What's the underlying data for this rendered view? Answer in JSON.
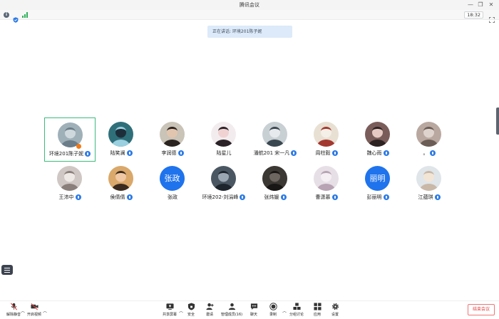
{
  "window": {
    "title": "腾讯会议"
  },
  "status": {
    "time": "18:32"
  },
  "banner": {
    "text": "正在讲话: 环境201陈子妮"
  },
  "colors": {
    "accent": "#1f73ec",
    "active_border": "#3dbb7d",
    "end_red": "#e43e3e",
    "mic_off": "#f07a16"
  },
  "participants": [
    {
      "name": "环境201陈子妮",
      "avatar": "photo-1",
      "active": true,
      "mic": true,
      "mic_off_badge": true
    },
    {
      "name": "陆笑澜",
      "avatar": "photo-2",
      "mic": true
    },
    {
      "name": "李润德",
      "avatar": "photo-3",
      "mic": true
    },
    {
      "name": "陆星儿",
      "avatar": "photo-4",
      "mic": false
    },
    {
      "name": "潘航201 宋一凡",
      "avatar": "photo-5",
      "mic": true
    },
    {
      "name": "周柱毅",
      "avatar": "photo-6",
      "mic": true
    },
    {
      "name": "魏心雨",
      "avatar": "photo-7",
      "mic": true
    },
    {
      "name": "。",
      "avatar": "photo-8",
      "mic": true
    },
    {
      "name": "王沛中",
      "avatar": "photo-9",
      "mic": true
    },
    {
      "name": "侯倩倩",
      "avatar": "photo-10",
      "mic": true
    },
    {
      "name": "张政",
      "avatar_text": "张政",
      "mic": false
    },
    {
      "name": "环境202-刘涓峰",
      "avatar": "photo-11",
      "mic": true
    },
    {
      "name": "张炜媛",
      "avatar": "photo-12",
      "mic": true
    },
    {
      "name": "曹潇慕",
      "avatar": "photo-13",
      "mic": true
    },
    {
      "name": "彭丽明",
      "avatar_text": "丽明",
      "mic": true
    },
    {
      "name": "江蕴琪",
      "avatar": "photo-14",
      "mic": true
    }
  ],
  "toolbar": {
    "left": [
      {
        "label": "解除静音",
        "icon": "mic-muted-icon"
      },
      {
        "label": "开启视频",
        "icon": "camera-off-icon"
      }
    ],
    "center": [
      {
        "label": "共享屏幕",
        "icon": "screen-share-icon"
      },
      {
        "label": "安全",
        "icon": "shield-icon"
      },
      {
        "label": "邀请",
        "icon": "invite-icon"
      },
      {
        "label": "管理成员(16)",
        "icon": "members-icon"
      },
      {
        "label": "聊天",
        "icon": "chat-icon"
      },
      {
        "label": "录制",
        "icon": "record-icon"
      },
      {
        "label": "分组讨论",
        "icon": "breakout-icon"
      },
      {
        "label": "应用",
        "icon": "apps-icon"
      },
      {
        "label": "设置",
        "icon": "settings-icon"
      }
    ],
    "end_label": "结束会议"
  }
}
